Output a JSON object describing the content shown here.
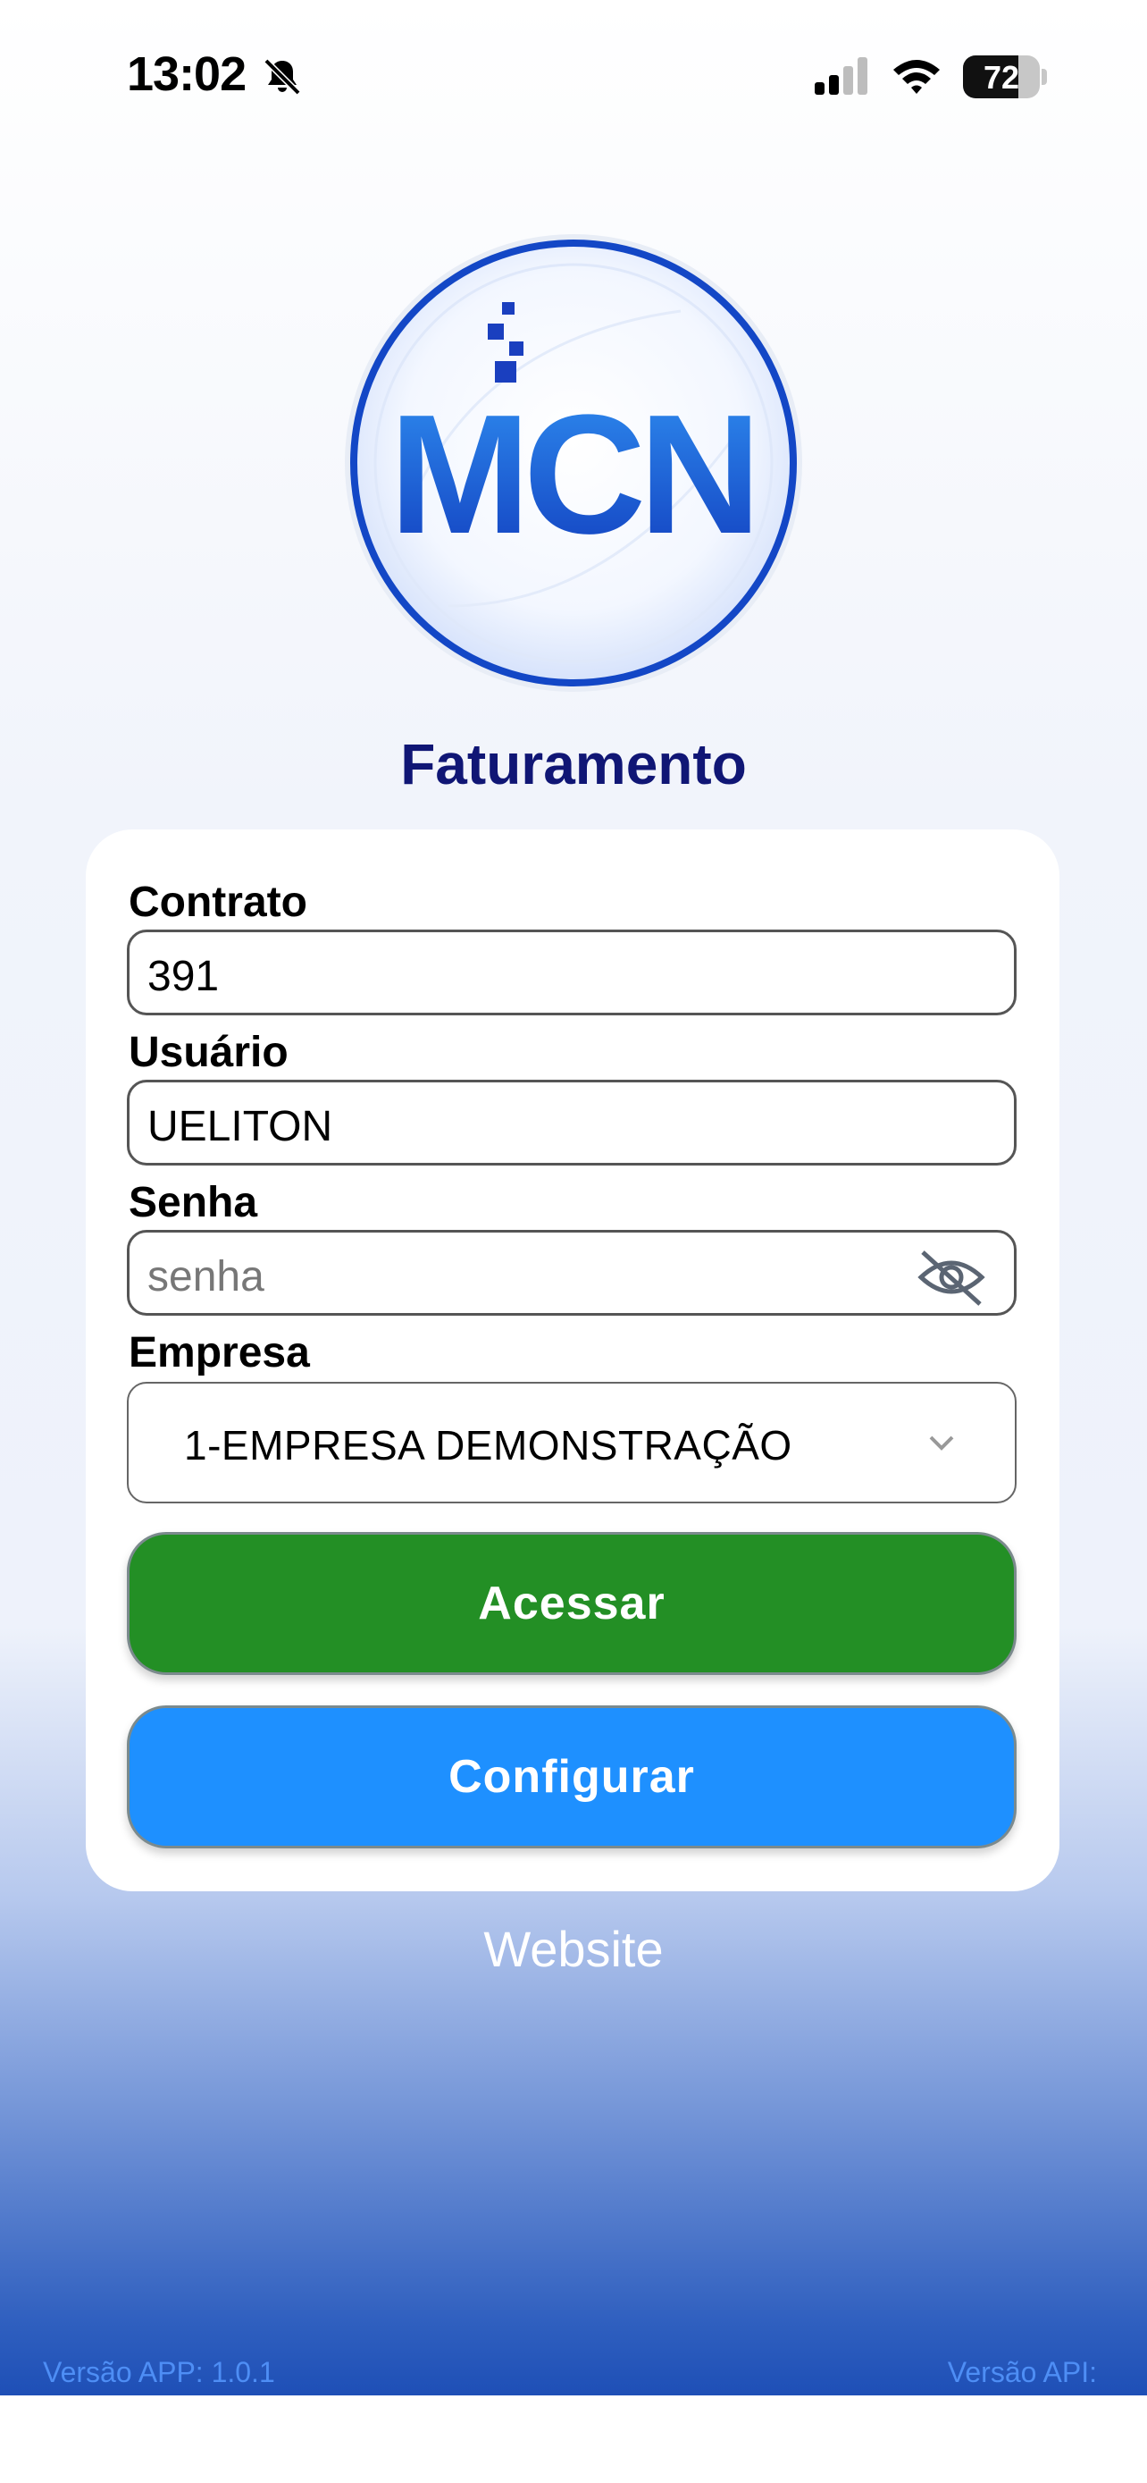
{
  "status_bar": {
    "time": "13:02",
    "battery_level": "72",
    "battery_fraction": 0.72
  },
  "logo": {
    "text": "MCN"
  },
  "app": {
    "title": "Faturamento"
  },
  "form": {
    "contrato": {
      "label": "Contrato",
      "value": "391"
    },
    "usuario": {
      "label": "Usuário",
      "value": "UELITON"
    },
    "senha": {
      "label": "Senha",
      "placeholder": "senha"
    },
    "empresa": {
      "label": "Empresa",
      "selected": "1-EMPRESA DEMONSTRAÇÃO"
    }
  },
  "buttons": {
    "acessar": "Acessar",
    "configurar": "Configurar"
  },
  "links": {
    "website": "Website"
  },
  "footer": {
    "app_version": "Versão APP: 1.0.1",
    "api_version": "Versão API:"
  },
  "colors": {
    "title": "#101675",
    "primary_green": "#238f25",
    "primary_blue": "#1e90ff",
    "version_text": "#4e8ef5"
  },
  "icons": {
    "bell": "bell-slash-icon",
    "signal": "cellular-signal-icon",
    "wifi": "wifi-icon",
    "battery": "battery-icon",
    "eye": "eye-slash-icon",
    "chevron": "chevron-down-icon"
  }
}
